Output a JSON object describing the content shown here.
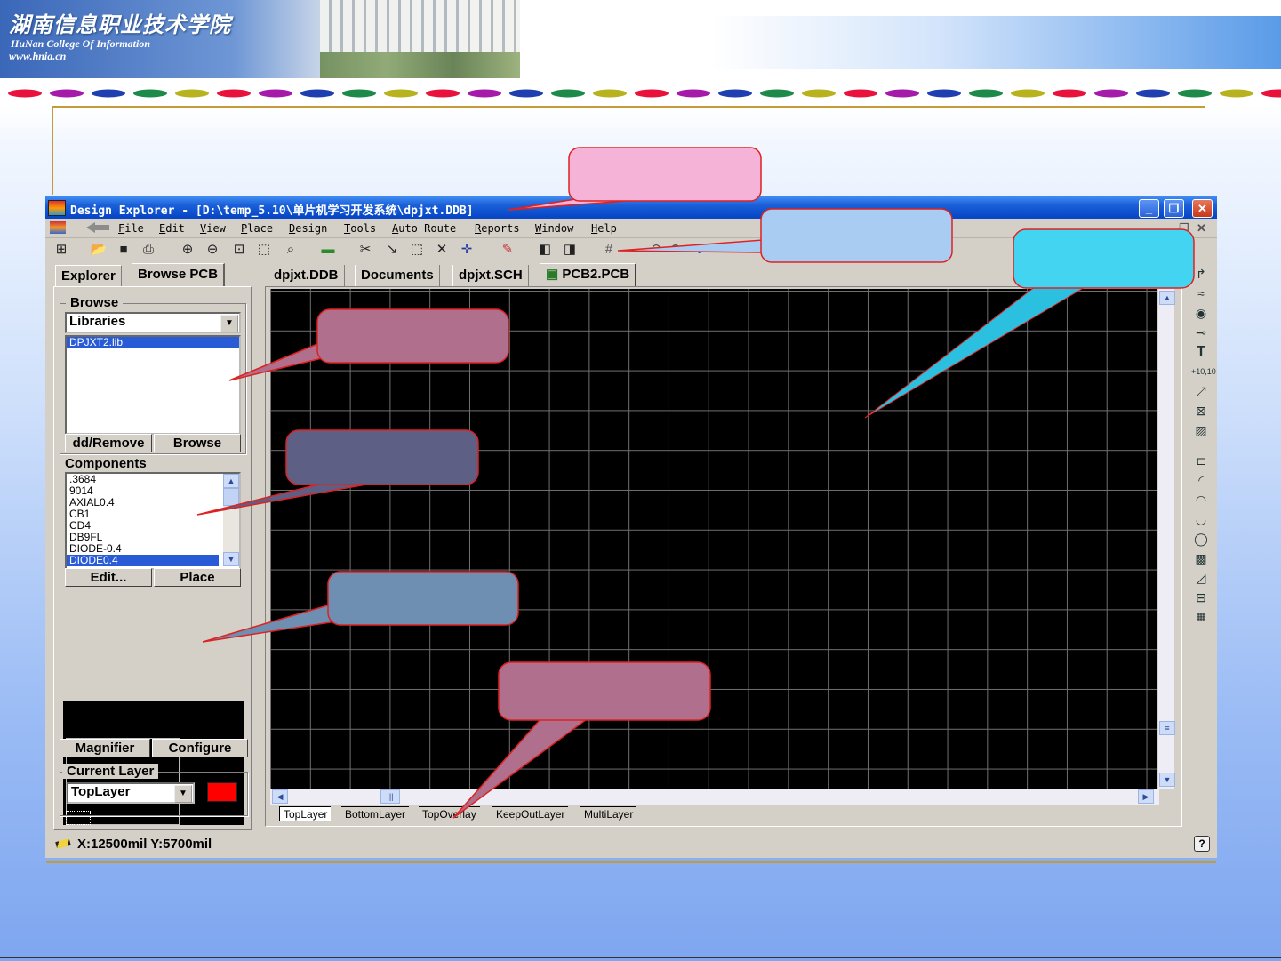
{
  "slide": {
    "banner_title": "湖南信息职业技术学院",
    "banner_subtitle": "HuNan  College  Of  Information",
    "banner_url": "www.hnia.cn"
  },
  "window": {
    "title": "Design Explorer - [D:\\temp_5.10\\单片机学习开发系统\\dpjxt.DDB]",
    "controls": [
      "_",
      "❐",
      "✕"
    ]
  },
  "menu": {
    "items": [
      "File",
      "Edit",
      "View",
      "Place",
      "Design",
      "Tools",
      "Auto Route",
      "Reports",
      "Window",
      "Help"
    ],
    "mdi_controls": [
      "_",
      "❐",
      "✕"
    ]
  },
  "toolbar": {
    "icons": [
      "design-manager-icon",
      "open-icon",
      "save-icon",
      "print-icon",
      "zoom-in-icon",
      "zoom-out-icon",
      "zoom-fit-icon",
      "zoom-area-icon",
      "find-icon",
      "library-icon",
      "cut-icon",
      "route-icon",
      "select-icon",
      "deselect-icon",
      "move-icon",
      "pencil-icon",
      "3d-view-icon",
      "browse-icon",
      "grid-icon",
      "undo-icon",
      "redo-icon",
      "help-icon"
    ]
  },
  "left_panel": {
    "tabs": [
      "Explorer",
      "Browse PCB"
    ],
    "active_tab": "Browse PCB",
    "browse": {
      "label": "Browse",
      "selected": "Libraries",
      "items": [
        "DPJXT2.lib"
      ],
      "selected_item": "DPJXT2.lib",
      "buttons": [
        "dd/Remove",
        "Browse"
      ]
    },
    "components": {
      "label": "Components",
      "items": [
        ".3684",
        "9014",
        "AXIAL0.4",
        "CB1",
        "CD4",
        "DB9FL",
        "DIODE-0.4",
        "DIODE0.4"
      ],
      "selected_item": "DIODE0.4",
      "buttons": [
        "Edit...",
        "Place"
      ]
    },
    "view_buttons": [
      "Magnifier",
      "Configure"
    ],
    "current_layer": {
      "label": "Current Layer",
      "selected": "TopLayer",
      "color": "#ff0000"
    }
  },
  "documents": {
    "tabs": [
      "dpjxt.DDB",
      "Documents",
      "dpjxt.SCH",
      "PCB2.PCB"
    ],
    "active_tab": "PCB2.PCB"
  },
  "layer_tabs": [
    "TopLayer",
    "BottomLayer",
    "TopOverlay",
    "KeepOutLayer",
    "MultiLayer"
  ],
  "status": {
    "coordinates": "X:12500mil Y:5700mil"
  },
  "colors": {
    "title_bar": "#0a4ec8",
    "canvas": "#000000",
    "grid": "#707070",
    "selection": "#2a5bd7",
    "callout_pink": "#f6b3d8",
    "callout_blue": "#a9cdf2",
    "callout_cyan": "#42d4f0",
    "callout_rose": "#b0708d",
    "callout_slate": "#5d5f85",
    "callout_steel": "#6e8fb2",
    "gold_line": "#c59a3a"
  }
}
